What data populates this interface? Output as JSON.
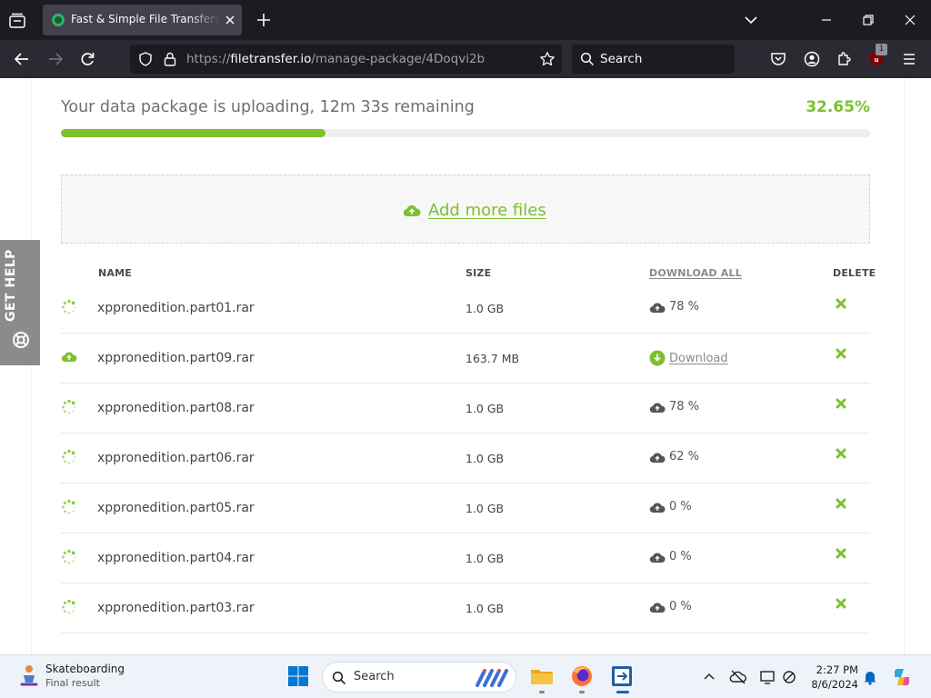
{
  "browser": {
    "tab_title": "Fast & Simple File Transfers - FileTransfer.io",
    "url_prefix": "https://",
    "url_host": "filetransfer.io",
    "url_path": "/manage-package/4Doqvi2b",
    "search_placeholder": "Search",
    "extension_badge": "1"
  },
  "upload": {
    "status_text": "Your data package is uploading, 12m 33s remaining",
    "percent_text": "32.65%",
    "progress_fraction": 0.3265,
    "add_more_label": "Add more files"
  },
  "table": {
    "col_name": "NAME",
    "col_size": "SIZE",
    "col_download_all": "DOWNLOAD ALL",
    "col_delete": "DELETE",
    "rows": [
      {
        "name": "xppronedition.part01.rar",
        "size": "1.0 GB",
        "progress": "78 %",
        "status": "uploading"
      },
      {
        "name": "xppronedition.part09.rar",
        "size": "163.7 MB",
        "progress": "Download",
        "status": "done"
      },
      {
        "name": "xppronedition.part08.rar",
        "size": "1.0 GB",
        "progress": "78 %",
        "status": "uploading"
      },
      {
        "name": "xppronedition.part06.rar",
        "size": "1.0 GB",
        "progress": "62 %",
        "status": "uploading"
      },
      {
        "name": "xppronedition.part05.rar",
        "size": "1.0 GB",
        "progress": "0 %",
        "status": "uploading"
      },
      {
        "name": "xppronedition.part04.rar",
        "size": "1.0 GB",
        "progress": "0 %",
        "status": "uploading"
      },
      {
        "name": "xppronedition.part03.rar",
        "size": "1.0 GB",
        "progress": "0 %",
        "status": "uploading"
      }
    ]
  },
  "help_tab": {
    "label": "GET HELP"
  },
  "taskbar": {
    "widget_title": "Skateboarding",
    "widget_subtitle": "Final result",
    "search_placeholder": "Search",
    "time": "2:27 PM",
    "date": "8/6/2024"
  },
  "colors": {
    "accent_green": "#7dc12f",
    "chrome_dark": "#1c1b22",
    "chrome_nav": "#2b2a33"
  }
}
